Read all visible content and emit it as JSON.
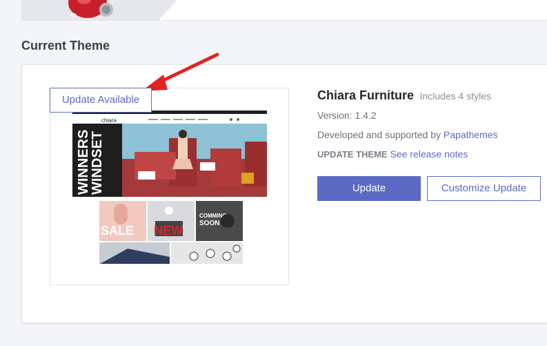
{
  "section_title": "Current Theme",
  "preview": {
    "badge_label": "Update Available",
    "mock_logo": "chiara",
    "mock_banner_text": [
      "WINNERS",
      "WINDSET"
    ],
    "mock_tiles": [
      "SALE",
      "NEW",
      "COMMING",
      "SOON"
    ]
  },
  "theme": {
    "name": "Chiara Furniture",
    "styles": "Includes 4 styles",
    "version": "Version: 1.4.2",
    "developed_prefix": "Developed and supported by",
    "developer": "Papathemes",
    "update_label": "UPDATE THEME",
    "release_notes": "See release notes"
  },
  "buttons": {
    "update": "Update",
    "customize_update": "Customize Update"
  },
  "colors": {
    "accent": "#5c6ac4",
    "arrow": "#e02424"
  }
}
